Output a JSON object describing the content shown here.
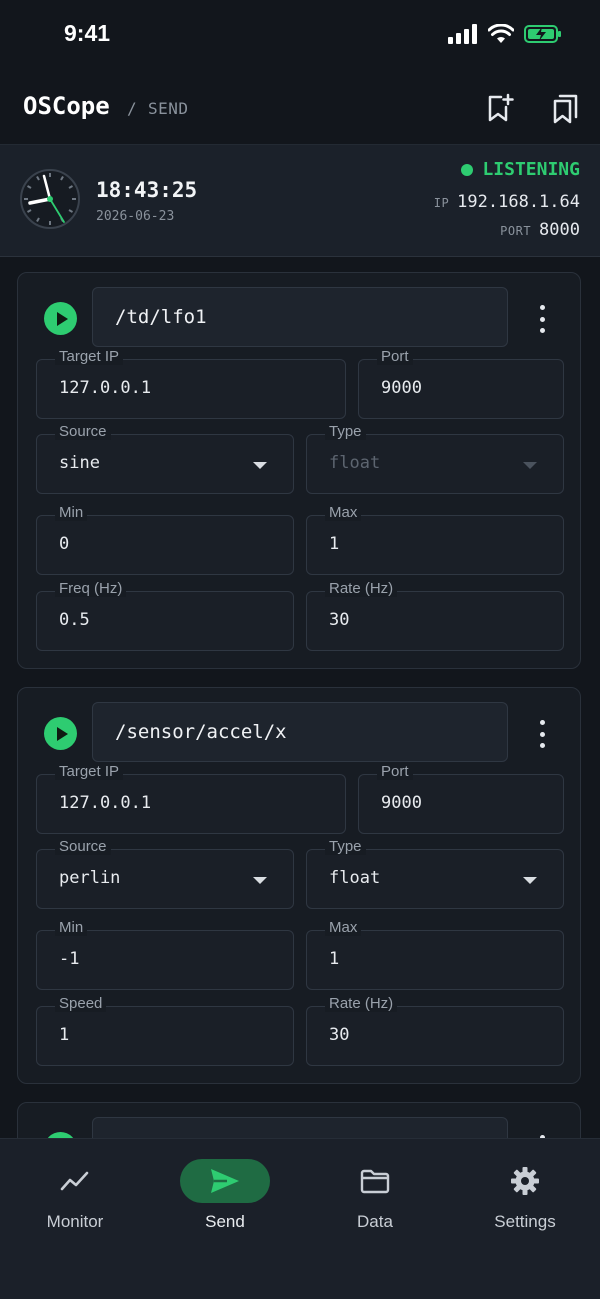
{
  "status_bar": {
    "time": "9:41"
  },
  "app_bar": {
    "title": "OSCope",
    "separator": "/",
    "section": "SEND"
  },
  "header": {
    "clock_time": "18:43:25",
    "clock_date": "2026-06-23",
    "status": "LISTENING",
    "ip_label": "IP",
    "ip_value": "192.168.1.64",
    "port_label": "PORT",
    "port_value": "8000",
    "status_color": "#2ecc71"
  },
  "cards": [
    {
      "address": "/td/lfo1",
      "target_ip_label": "Target IP",
      "target_ip": "127.0.0.1",
      "port_label": "Port",
      "port": "9000",
      "source_label": "Source",
      "source": "sine",
      "type_label": "Type",
      "type": "float",
      "type_enabled": false,
      "min_label": "Min",
      "min": "0",
      "max_label": "Max",
      "max": "1",
      "p1_label": "Freq (Hz)",
      "p1": "0.5",
      "rate_label": "Rate (Hz)",
      "rate": "30"
    },
    {
      "address": "/sensor/accel/x",
      "target_ip_label": "Target IP",
      "target_ip": "127.0.0.1",
      "port_label": "Port",
      "port": "9000",
      "source_label": "Source",
      "source": "perlin",
      "type_label": "Type",
      "type": "float",
      "type_enabled": true,
      "min_label": "Min",
      "min": "-1",
      "max_label": "Max",
      "max": "1",
      "p1_label": "Speed",
      "p1": "1",
      "rate_label": "Rate (Hz)",
      "rate": "30"
    }
  ],
  "nav": [
    {
      "label": "Monitor",
      "icon": "chart-line-icon",
      "active": false
    },
    {
      "label": "Send",
      "icon": "send-icon",
      "active": true
    },
    {
      "label": "Data",
      "icon": "folder-icon",
      "active": false
    },
    {
      "label": "Settings",
      "icon": "gear-icon",
      "active": false
    }
  ],
  "accent": "#2ecc71"
}
